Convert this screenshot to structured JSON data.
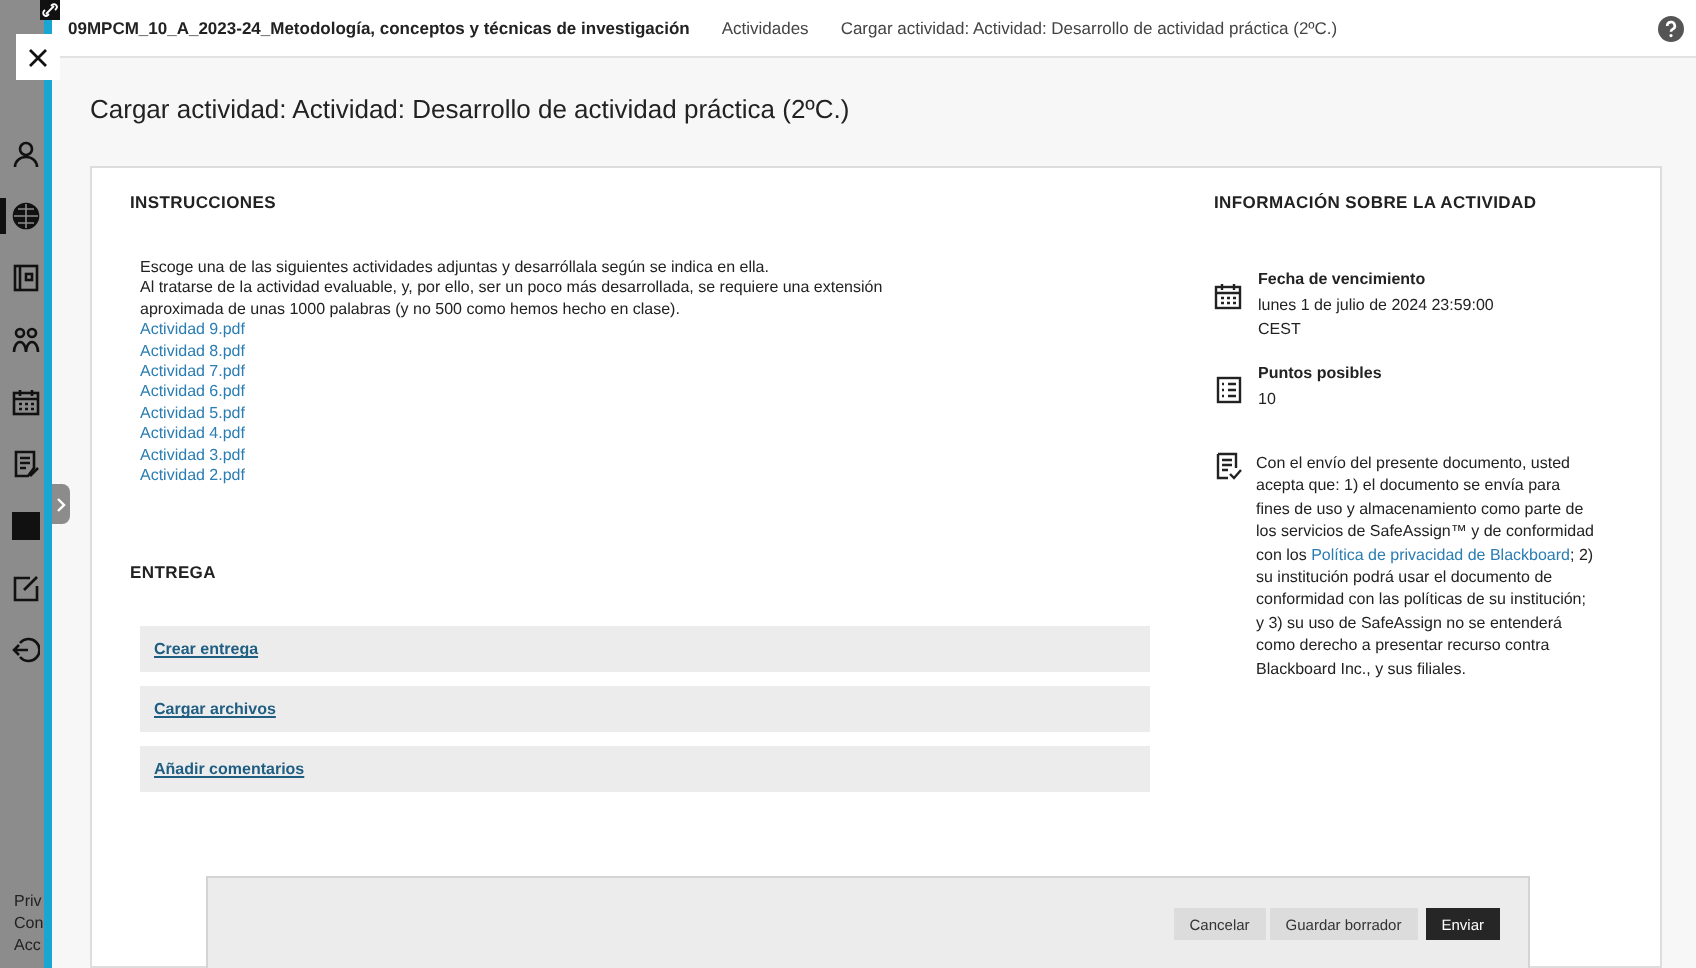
{
  "top_bar": {
    "course": "09MPCM_10_A_2023-24_Metodología, conceptos y técnicas de investigación",
    "breadcrumbs": [
      "Actividades",
      "Cargar actividad: Actividad: Desarrollo de actividad práctica (2ºC.)"
    ]
  },
  "sidebar": {
    "items": [
      {
        "kind": "user",
        "selected": false
      },
      {
        "kind": "globe",
        "selected": true
      },
      {
        "kind": "book",
        "selected": false
      },
      {
        "kind": "people",
        "selected": false
      },
      {
        "kind": "calendar",
        "selected": false
      },
      {
        "kind": "document",
        "selected": false
      },
      {
        "kind": "square",
        "selected": false
      },
      {
        "kind": "edit",
        "selected": false
      },
      {
        "kind": "logout",
        "selected": false
      }
    ],
    "footer": [
      "Priv",
      "Con",
      "Acc"
    ]
  },
  "page_title": "Cargar actividad: Actividad: Desarrollo de actividad práctica (2ºC.)",
  "instructions": {
    "heading": "INSTRUCCIONES",
    "paragraphs": [
      "Escoge una de las siguientes actividades adjuntas y desarróllala según se indica en ella.",
      "Al tratarse de la actividad evaluable, y, por ello, ser un poco más desarrollada, se requiere una extensión aproximada de unas 1000 palabras (y no 500 como hemos hecho en clase)."
    ],
    "attachments": [
      "Actividad 9.pdf",
      "Actividad 8.pdf",
      "Actividad 7.pdf",
      "Actividad 6.pdf",
      "Actividad 5.pdf",
      "Actividad 4.pdf",
      "Actividad 3.pdf",
      "Actividad 2.pdf"
    ]
  },
  "submission": {
    "heading": "ENTREGA",
    "actions": [
      "Crear entrega",
      "Cargar archivos",
      "Añadir comentarios"
    ]
  },
  "activity_info": {
    "heading": "INFORMACIÓN SOBRE LA ACTIVIDAD",
    "due_date": {
      "label": "Fecha de vencimiento",
      "value": "lunes 1 de julio de 2024 23:59:00",
      "timezone": "CEST"
    },
    "points": {
      "label": "Puntos posibles",
      "value": "10"
    },
    "notice": {
      "before": "Con el envío del presente documento, usted acepta que: 1) el documento se envía para fines de uso y almacenamiento como parte de los servicios de SafeAssign™ y de conformidad con los ",
      "link": "Política de privacidad de Blackboard",
      "after": "; 2) su institución podrá usar el documento de conformidad con las políticas de su institución; y 3) su uso de SafeAssign no se entenderá como derecho a presentar recurso contra Blackboard Inc., y sus filiales."
    }
  },
  "footer_buttons": [
    {
      "label": "Cancelar",
      "kind": "secondary"
    },
    {
      "label": "Guardar borrador",
      "kind": "secondary"
    },
    {
      "label": "Enviar",
      "kind": "primary"
    }
  ]
}
